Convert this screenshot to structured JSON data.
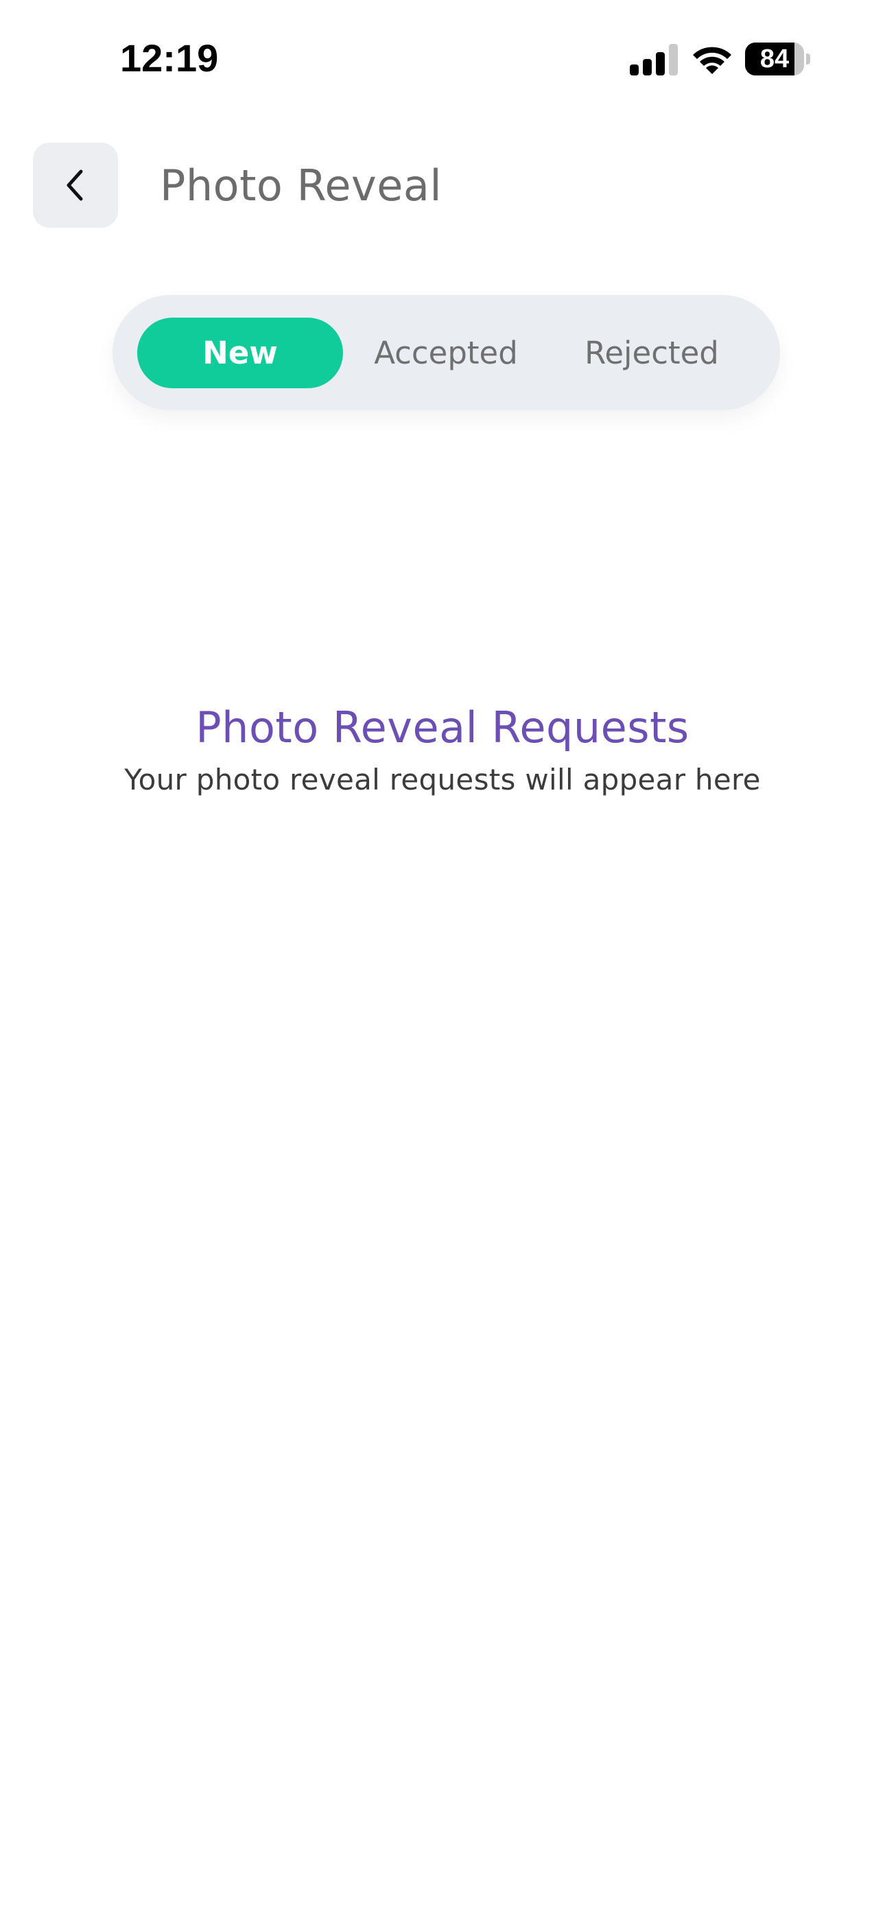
{
  "status_bar": {
    "time": "12:19",
    "battery_label": "84",
    "battery_level": 0.84,
    "signal_bars_active": 3,
    "signal_bars_total": 4,
    "icons": [
      "cellular-signal-icon",
      "wifi-icon",
      "battery-icon"
    ]
  },
  "header": {
    "back_icon": "chevron-left-icon",
    "title": "Photo Reveal"
  },
  "tabs": [
    {
      "label": "New",
      "active": true
    },
    {
      "label": "Accepted",
      "active": false
    },
    {
      "label": "Rejected",
      "active": false
    }
  ],
  "empty_state": {
    "title": "Photo Reveal Requests",
    "subtitle": "Your photo reveal requests will appear here"
  },
  "colors": {
    "accent_green": "#10cc9a",
    "title_purple": "#6b4fb4",
    "segment_bg": "#eaedf1",
    "back_button_bg": "#eceef2"
  }
}
